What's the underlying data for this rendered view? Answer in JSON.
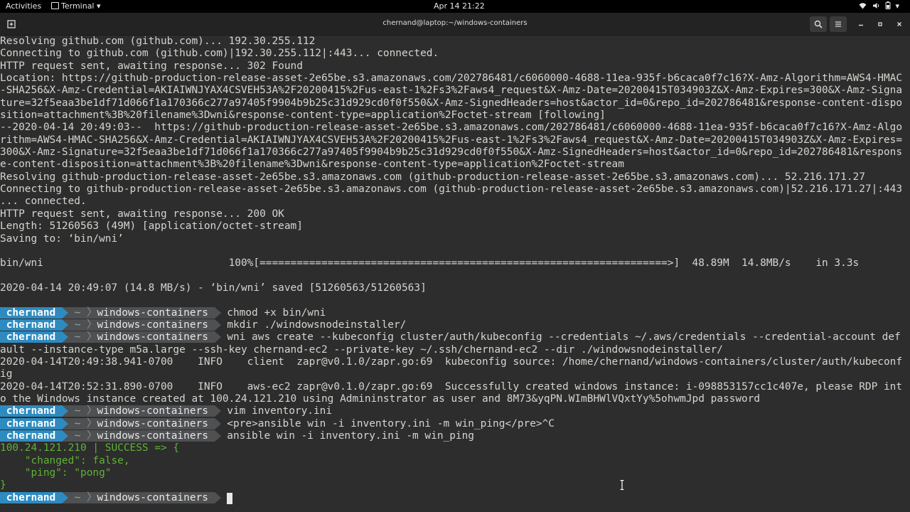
{
  "topbar": {
    "activities": "Activities",
    "app": "Terminal",
    "clock": "Apr 14  21:22"
  },
  "window": {
    "title": "chernand@laptop:~/windows-containers"
  },
  "prompt": {
    "user": "chernand",
    "tilde": "~",
    "dir": "windows-containers"
  },
  "output_top": [
    "Resolving github.com (github.com)... 192.30.255.112",
    "Connecting to github.com (github.com)|192.30.255.112|:443... connected.",
    "HTTP request sent, awaiting response... 302 Found",
    "Location: https://github-production-release-asset-2e65be.s3.amazonaws.com/202786481/c6060000-4688-11ea-935f-b6caca0f7c16?X-Amz-Algorithm=AWS4-HMAC",
    "-SHA256&X-Amz-Credential=AKIAIWNJYAX4CSVEH53A%2F20200415%2Fus-east-1%2Fs3%2Faws4_request&X-Amz-Date=20200415T034903Z&X-Amz-Expires=300&X-Amz-Signa",
    "ture=32f5eaa3be1df71d066f1a170366c277a97405f9904b9b25c31d929cd0f0f550&X-Amz-SignedHeaders=host&actor_id=0&repo_id=202786481&response-content-dispo",
    "sition=attachment%3B%20filename%3Dwni&response-content-type=application%2Foctet-stream [following]",
    "--2020-04-14 20:49:03--  https://github-production-release-asset-2e65be.s3.amazonaws.com/202786481/c6060000-4688-11ea-935f-b6caca0f7c16?X-Amz-Algo",
    "rithm=AWS4-HMAC-SHA256&X-Amz-Credential=AKIAIWNJYAX4CSVEH53A%2F20200415%2Fus-east-1%2Fs3%2Faws4_request&X-Amz-Date=20200415T034903Z&X-Amz-Expires=",
    "300&X-Amz-Signature=32f5eaa3be1df71d066f1a170366c277a97405f9904b9b25c31d929cd0f0f550&X-Amz-SignedHeaders=host&actor_id=0&repo_id=202786481&respons",
    "e-content-disposition=attachment%3B%20filename%3Dwni&response-content-type=application%2Foctet-stream",
    "Resolving github-production-release-asset-2e65be.s3.amazonaws.com (github-production-release-asset-2e65be.s3.amazonaws.com)... 52.216.171.27",
    "Connecting to github-production-release-asset-2e65be.s3.amazonaws.com (github-production-release-asset-2e65be.s3.amazonaws.com)|52.216.171.27|:443",
    "... connected.",
    "HTTP request sent, awaiting response... 200 OK",
    "Length: 51260563 (49M) [application/octet-stream]",
    "Saving to: ‘bin/wni’",
    "",
    "bin/wni                              100%[==================================================================>]  48.89M  14.8MB/s    in 3.3s",
    "",
    "2020-04-14 20:49:07 (14.8 MB/s) - ‘bin/wni’ saved [51260563/51260563]",
    ""
  ],
  "commands_1": [
    "chmod +x bin/wni",
    "mkdir ./windowsnodeinstaller/",
    "wni aws create --kubeconfig cluster/auth/kubeconfig --credentials ~/.aws/credentials --credential-account def"
  ],
  "output_mid": [
    "ault --instance-type m5a.large --ssh-key chernand-ec2 --private-key ~/.ssh/chernand-ec2 --dir ./windowsnodeinstaller/",
    "2020-04-14T20:49:38.941-0700    INFO    client  zapr@v0.1.0/zapr.go:69  kubeconfig source: /home/chernand/windows-containers/cluster/auth/kubeconf",
    "ig",
    "2020-04-14T20:52:31.890-0700    INFO    aws-ec2 zapr@v0.1.0/zapr.go:69  Successfully created windows instance: i-098853157cc1c407e, please RDP int",
    "o the Windows instance created at 100.24.121.210 using Admininstrator as user and 8M73&yqPN.WImBHWlVQxtYy%5ohwmJpd password"
  ],
  "commands_2": [
    "vim inventory.ini",
    "<pre>ansible win -i inventory.ini -m win_ping</pre>^C",
    "ansible win -i inventory.ini -m win_ping"
  ],
  "output_green": [
    "100.24.121.210 | SUCCESS => {",
    "    \"changed\": false,",
    "    \"ping\": \"pong\"",
    "}"
  ],
  "colors": {
    "background": "#2d2d2d",
    "prompt_user_bg": "#2e8bc0",
    "prompt_dir_bg": "#4e5052",
    "success_green": "#5fb236"
  },
  "icons": [
    "terminal-app-icon",
    "new-tab-icon",
    "search-icon",
    "hamburger-menu-icon",
    "minimize-icon",
    "maximize-icon",
    "close-icon",
    "wifi-icon",
    "volume-icon",
    "battery-icon",
    "system-menu-icon"
  ]
}
